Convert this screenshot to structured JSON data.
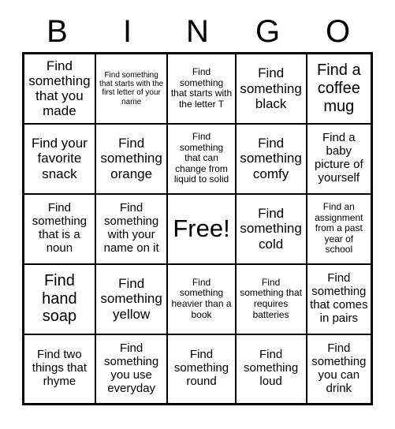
{
  "card": {
    "title_letters": [
      "B",
      "I",
      "N",
      "G",
      "O"
    ],
    "colors": {
      "background": "#ffffff",
      "text": "#000000",
      "border": "#000000"
    },
    "rows": [
      [
        {
          "text": "Find something that you made",
          "size": "lg"
        },
        {
          "text": "Find something that starts with the first letter of your name",
          "size": "xs"
        },
        {
          "text": "Find something that starts with the letter T",
          "size": "sm"
        },
        {
          "text": "Find something black",
          "size": "lg"
        },
        {
          "text": "Find a coffee mug",
          "size": "xl"
        }
      ],
      [
        {
          "text": "Find your favorite snack",
          "size": "lg"
        },
        {
          "text": "Find something orange",
          "size": "lg"
        },
        {
          "text": "Find something that can change from liquid to solid",
          "size": "sm"
        },
        {
          "text": "Find something comfy",
          "size": "lg"
        },
        {
          "text": "Find a baby picture of yourself",
          "size": "md"
        }
      ],
      [
        {
          "text": "Find something that is a noun",
          "size": "md"
        },
        {
          "text": "Find something with your name on it",
          "size": "md"
        },
        {
          "text": "Free!",
          "size": "free"
        },
        {
          "text": "Find something cold",
          "size": "lg"
        },
        {
          "text": "Find an assignment from a past year of school",
          "size": "sm"
        }
      ],
      [
        {
          "text": "Find hand soap",
          "size": "xl"
        },
        {
          "text": "Find something yellow",
          "size": "lg"
        },
        {
          "text": "Find something heavier than a book",
          "size": "sm"
        },
        {
          "text": "Find something that requires batteries",
          "size": "sm"
        },
        {
          "text": "Find something that comes in pairs",
          "size": "md"
        }
      ],
      [
        {
          "text": "Find two things that rhyme",
          "size": "md"
        },
        {
          "text": "Find something you use everyday",
          "size": "md"
        },
        {
          "text": "Find something round",
          "size": "md"
        },
        {
          "text": "Find something loud",
          "size": "md"
        },
        {
          "text": "Find something you can drink",
          "size": "md"
        }
      ]
    ]
  }
}
